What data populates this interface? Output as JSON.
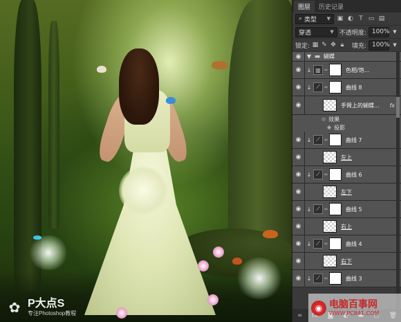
{
  "canvas": {
    "brand": {
      "name": "P大点S",
      "subtitle": "专注Photoshop教程"
    }
  },
  "panel": {
    "tabs": [
      "图层",
      "历史记录"
    ],
    "active_tab": 0,
    "filter": {
      "label": "类型",
      "icons": [
        "image-icon",
        "adjust-circle-icon",
        "text-tool-icon",
        "shape-icon",
        "smart-object-icon"
      ]
    },
    "blend": {
      "mode": "穿透",
      "opacity_label": "不透明度:",
      "opacity": "100%"
    },
    "lock": {
      "label": "锁定:",
      "fill_label": "填充:",
      "fill": "100%"
    },
    "layers": [
      {
        "kind": "group",
        "name": "蝴蝶"
      },
      {
        "kind": "adjustment",
        "name": "色相/饱...",
        "icon": "hue-sat-icon"
      },
      {
        "kind": "adjustment",
        "name": "曲线 8",
        "icon": "curves-icon"
      },
      {
        "kind": "pixel",
        "name": "手臂上的蝴蝶...",
        "fx": "fx"
      },
      {
        "kind": "effects",
        "label": "效果"
      },
      {
        "kind": "effect",
        "label": "投影"
      },
      {
        "kind": "adjustment",
        "name": "曲线 7",
        "icon": "curves-icon"
      },
      {
        "kind": "pixel",
        "name": "左上"
      },
      {
        "kind": "adjustment",
        "name": "曲线 6",
        "icon": "curves-icon"
      },
      {
        "kind": "pixel",
        "name": "左下"
      },
      {
        "kind": "adjustment",
        "name": "曲线 5",
        "icon": "curves-icon"
      },
      {
        "kind": "pixel",
        "name": "右上"
      },
      {
        "kind": "adjustment",
        "name": "曲线 4",
        "icon": "curves-icon"
      },
      {
        "kind": "pixel",
        "name": "右下"
      },
      {
        "kind": "adjustment",
        "name": "曲线 3",
        "icon": "curves-icon"
      }
    ],
    "footer_icons": [
      "link-icon",
      "fx-icon",
      "mask-icon",
      "adjustment-icon",
      "folder-icon",
      "new-layer-icon",
      "trash-icon"
    ]
  },
  "watermark": {
    "title": "电脑百事网",
    "url": "WWW.PC841.COM"
  }
}
